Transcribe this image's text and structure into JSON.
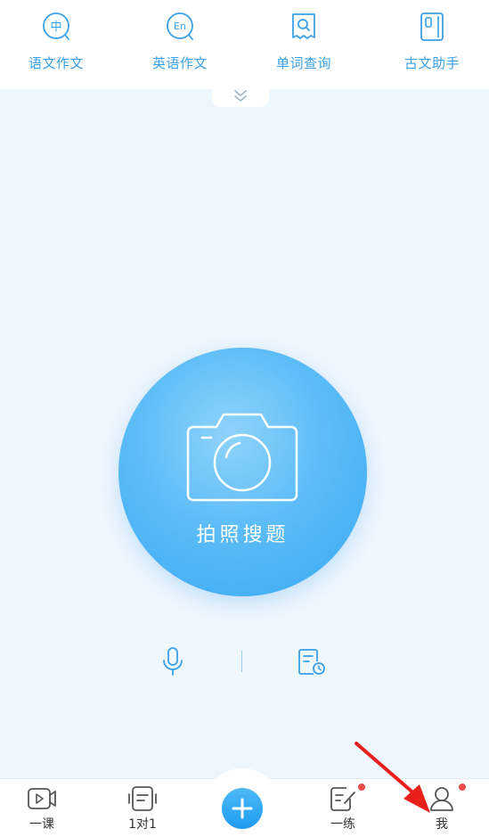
{
  "tools": [
    {
      "label": "语文作文",
      "icon": "chinese-essay-icon"
    },
    {
      "label": "英语作文",
      "icon": "english-essay-icon"
    },
    {
      "label": "单词查询",
      "icon": "word-lookup-icon"
    },
    {
      "label": "古文助手",
      "icon": "classical-chinese-icon"
    }
  ],
  "tool_glyphs": {
    "chinese": "中",
    "english": "En"
  },
  "camera": {
    "label": "拍照搜题"
  },
  "tabs": [
    {
      "label": "一课"
    },
    {
      "label": "1对1"
    },
    {
      "label": "一练"
    },
    {
      "label": "我"
    }
  ],
  "colors": {
    "accent": "#3aa0e8",
    "background": "#eef6fe",
    "camera_gradient_light": "#8fd3fb",
    "camera_gradient_dark": "#38a9f3",
    "badge": "#f04a4a",
    "annotation_arrow": "#e8201c"
  }
}
